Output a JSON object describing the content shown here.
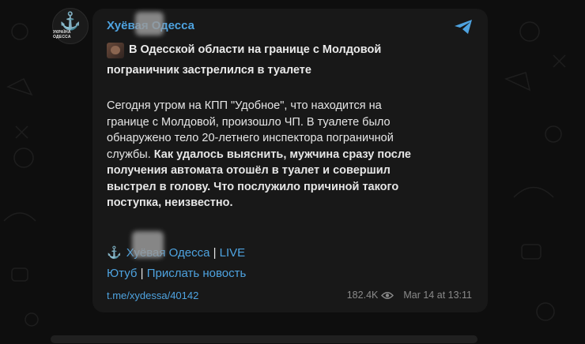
{
  "channel": {
    "avatar_text": "УКРАЇНА ОДЕССА",
    "name": "Хуёвая Одесса"
  },
  "post": {
    "title_line1": "В Одесской области на границе с Молдовой",
    "title_line2": "пограничник застрелился в туалете",
    "body_line1": "Сегодня утром на КПП \"Удобное\", что находится на",
    "body_line2": "границе с Молдовой, произошло ЧП. В туалете было",
    "body_line3": "обнаружено тело 20-летнего инспектора пограничной",
    "body_line4_a": "службы. ",
    "body_line4_b": "Как удалось выяснить, мужчина сразу после",
    "body_line5": "получения автомата отошёл в туалет и совершил",
    "body_line6": "выстрел в голову. Что послужило причиной такого",
    "body_line7": "поступка, неизвестно."
  },
  "signature": {
    "channel": "Хуёвая Одесса",
    "live": "LIVE",
    "youtube": "Ютуб",
    "send_news": "Прислать новость",
    "separator": "|"
  },
  "footer": {
    "link": "t.me/xydessa/40142",
    "views": "182.4K",
    "date": "Mar 14 at 13:11"
  },
  "icons": [
    "anchor-icon",
    "share-icon",
    "eye-icon"
  ],
  "colors": {
    "background": "#0e0e0e",
    "bubble": "#181818",
    "link": "#4ea3e0",
    "text": "#e6e6e6",
    "meta": "#8a8a8a",
    "anchor": "#f2a63a"
  }
}
